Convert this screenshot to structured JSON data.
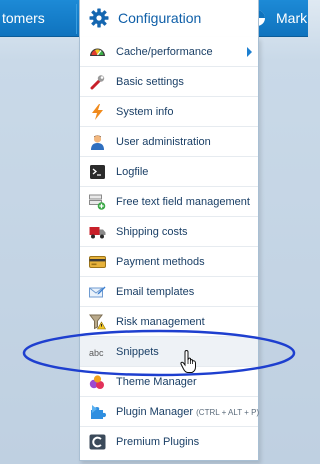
{
  "topbar": {
    "left_item": "tomers",
    "active_item": "Configuration",
    "right_item": "Mark"
  },
  "menu": {
    "items": [
      {
        "label": "Cache/performance",
        "icon": "gauge-icon"
      },
      {
        "label": "Basic settings",
        "icon": "wrench-icon"
      },
      {
        "label": "System info",
        "icon": "lightning-icon"
      },
      {
        "label": "User administration",
        "icon": "user-icon"
      },
      {
        "label": "Logfile",
        "icon": "terminal-icon"
      },
      {
        "label": "Free text field management",
        "icon": "text-field-add-icon"
      },
      {
        "label": "Shipping costs",
        "icon": "truck-icon"
      },
      {
        "label": "Payment methods",
        "icon": "credit-card-icon"
      },
      {
        "label": "Email templates",
        "icon": "email-template-icon"
      },
      {
        "label": "Risk management",
        "icon": "funnel-warning-icon"
      },
      {
        "label": "Snippets",
        "icon": "abc-icon"
      },
      {
        "label": "Theme Manager",
        "icon": "theme-icon"
      },
      {
        "label": "Plugin Manager",
        "shortcut": "(CTRL + ALT + P)",
        "icon": "puzzle-icon"
      },
      {
        "label": "Premium Plugins",
        "icon": "premium-plugin-icon"
      }
    ]
  },
  "colors": {
    "topbar": "#1a84d0",
    "active_text": "#0f5fa8",
    "menu_text": "#1a3f66",
    "annotation": "#1e3fcf"
  }
}
